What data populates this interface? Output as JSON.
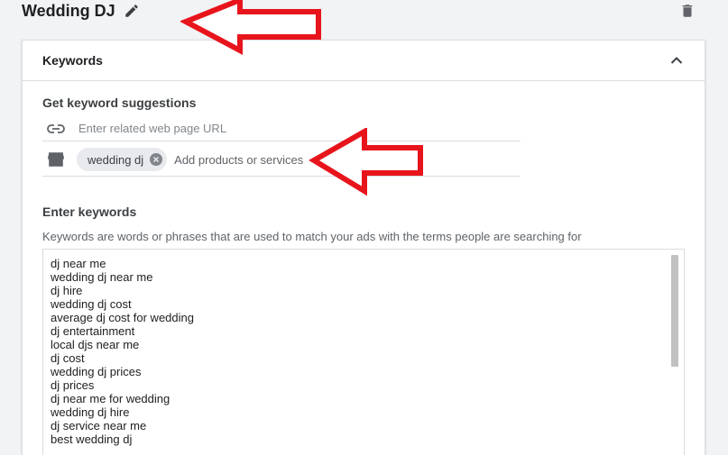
{
  "adgroup": {
    "title": "Wedding DJ"
  },
  "colors": {
    "arrow": "#e8141c",
    "chip_bg": "#e8eaed",
    "border": "#dadce0"
  },
  "icons": {
    "edit": "pencil-icon",
    "delete": "trash-icon",
    "collapse": "chevron-up-icon",
    "link": "link-icon",
    "store": "store-icon",
    "chip_remove": "close-circle-icon"
  },
  "keywords_card": {
    "title": "Keywords",
    "suggestions": {
      "title": "Get keyword suggestions",
      "url_placeholder": "Enter related web page URL",
      "products_placeholder": "Add products or services",
      "chips": [
        "wedding dj"
      ]
    },
    "enter": {
      "title": "Enter keywords",
      "description": "Keywords are words or phrases that are used to match your ads with the terms people are searching for",
      "keywords": [
        "dj near me",
        "wedding dj near me",
        "dj hire",
        "wedding dj cost",
        "average dj cost for wedding",
        "dj entertainment",
        "local djs near me",
        "dj cost",
        "wedding dj prices",
        "dj prices",
        "dj near me for wedding",
        "wedding dj hire",
        "dj service near me",
        "best wedding dj"
      ]
    }
  }
}
